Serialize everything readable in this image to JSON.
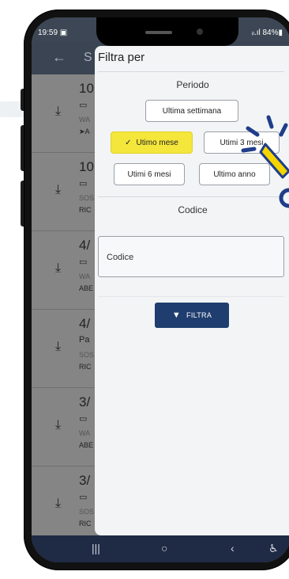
{
  "status_bar": {
    "time": "19:59 ▣",
    "battery": "ᵢₗ.ıl 84%▮"
  },
  "app_bar": {
    "back_icon": "arrow-left-icon",
    "title_partial": "S"
  },
  "list_rows": [
    {
      "date": "10",
      "icon": "▭",
      "line1": "WA",
      "line2": "➤A"
    },
    {
      "date": "10",
      "icon": "▭",
      "line1": "SOS",
      "line2": "RIC"
    },
    {
      "date": "4/",
      "icon": "▭",
      "line1": "WA",
      "line2": "ABE"
    },
    {
      "date": "4/",
      "icon": "Pa",
      "line1": "SOS",
      "line2": "RIC"
    },
    {
      "date": "3/",
      "icon": "▭",
      "line1": "WA",
      "line2": "ABE"
    },
    {
      "date": "3/",
      "icon": "▭",
      "line1": "SOS",
      "line2": "RIC"
    }
  ],
  "filter": {
    "title": "Filtra per",
    "period_label": "Periodo",
    "options": {
      "last_week": "Ultima settimana",
      "last_month": "Utimo mese",
      "last_3_months": "Utimi 3 mesi",
      "last_6_months": "Utimi 6 mesi",
      "last_year": "Ultimo anno"
    },
    "selected_option": "last_month",
    "code_label": "Codice",
    "code_placeholder": "Codice",
    "button_label": "FILTRA"
  },
  "nav_bar": {
    "recent": "|||",
    "home": "○",
    "back": "‹",
    "accessibility": "♿"
  },
  "colors": {
    "accent": "#1f3d6e",
    "selected_chip": "#f4e63a",
    "highlight": "#f5d400",
    "tap_blue": "#1f3d8a"
  }
}
